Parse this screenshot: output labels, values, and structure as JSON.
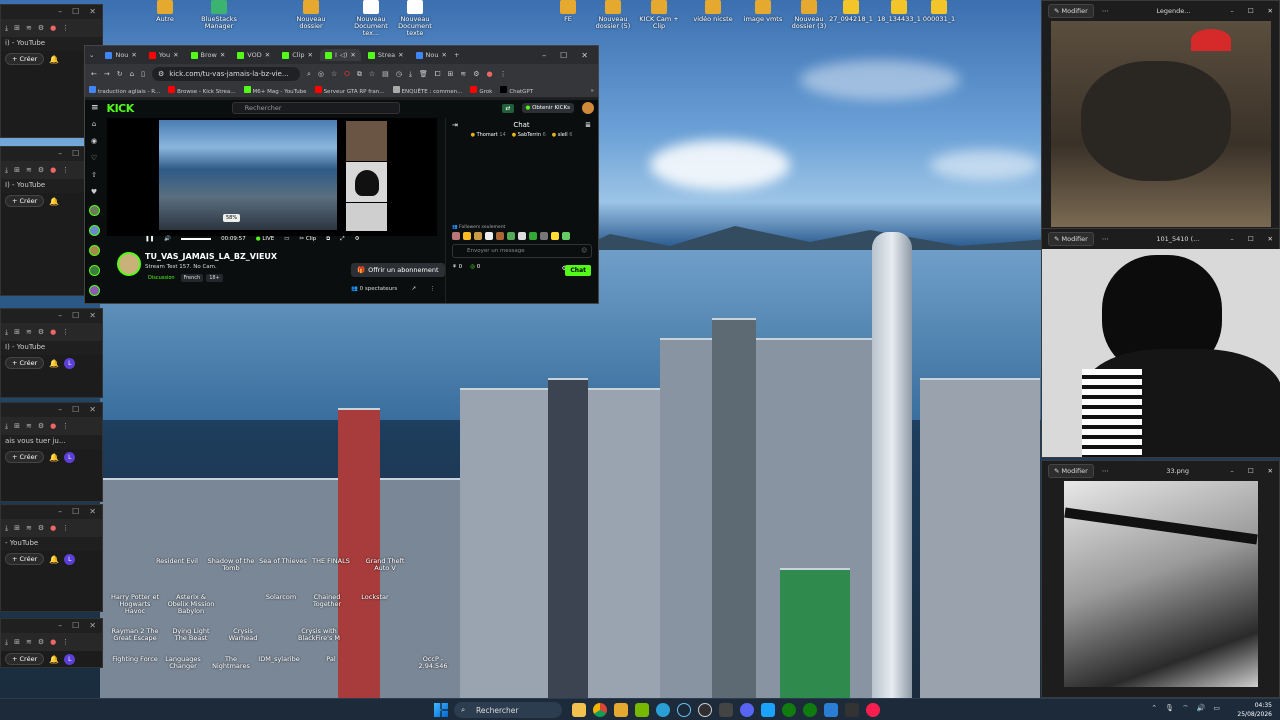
{
  "desktop_icons": [
    "Autre",
    "BlueStacks Manager",
    "Nouveau dossier",
    "Nouveau Document tex...",
    "Nouveau Document texte",
    "FE",
    "Nouveau dossier (5)",
    "KICK Cam + Clip",
    "vidéo nicste",
    "image vmts",
    "Nouveau dossier (3)",
    "27_094218_1",
    "18_134433_1",
    "000031_1"
  ],
  "game_icons": [
    "Resident Evil",
    "Shadow of the Tomb",
    "Sea of Thieves",
    "THE FINALS",
    "Grand Theft Auto V",
    "Harry Potter et Hogwarts Havoc",
    "Asterix & Obelix Mission Babylon",
    "Rayman 2 The Great Escape",
    "Dying Light The Beast",
    "Crysis Warhead",
    "Crysis with BlackFire's M",
    "Fighting Force",
    "Languages Changer",
    "The Nightmares",
    "IDM_sylaribe",
    "Pal",
    "Chained Together",
    "Lockstar",
    "Solarcom",
    "OccP - 2.94.546"
  ],
  "side_windows": [
    {
      "tab": "i) - YouTube",
      "creer": "Créer",
      "badge": ""
    },
    {
      "tab": "I) - YouTube",
      "creer": "Créer",
      "badge": ""
    },
    {
      "tab": "I) - YouTube",
      "creer": "Créer",
      "badge": "L"
    },
    {
      "tab": "ais vous tuer ju...",
      "creer": "Créer",
      "badge": "L"
    },
    {
      "tab": "- YouTube",
      "creer": "Créer",
      "badge": "L"
    },
    {
      "tab": "",
      "creer": "Créer",
      "badge": "L"
    }
  ],
  "browser": {
    "tabs": [
      "Nou",
      "You",
      "Brow",
      "VOD",
      "Clip",
      "I",
      "Strea",
      "Nou"
    ],
    "url": "kick.com/tu-vas-jamais-la-bz-vie...",
    "bookmarks": [
      "traduction agliais - R...",
      "Browse - Kick Strea...",
      "M6+ Mag - YouTube",
      "Serveur GTA RP fran...",
      "ENQUÊTE : commen...",
      "Grok",
      "ChatGPT"
    ]
  },
  "kick": {
    "logo": "KICK",
    "search_placeholder": "Rechercher",
    "get_kicks": "Obtenir KICKs",
    "stream_time": "00:09:57",
    "live_label": "LIVE",
    "clip_label": "Clip",
    "volume": "58%",
    "channel_name": "TU_VAS_JAMAIS_LA_BZ_VIEUX",
    "stream_title": "Stream Test 157. No Cam.",
    "tags": [
      "Discussion",
      "French",
      "18+"
    ],
    "subscribe": "Offrir un abonnement",
    "viewers": "0 spectateurs",
    "chat_header": "Chat",
    "gifters": [
      {
        "name": "Thomart",
        "count": "14"
      },
      {
        "name": "SabTerrin",
        "count": "6"
      },
      {
        "name": "slell",
        "count": "6"
      }
    ],
    "followers_only": "Followers seulement",
    "chat_placeholder": "Envoyer un message",
    "chat_button": "Chat",
    "chat_count": "0"
  },
  "viewers": [
    {
      "modify": "Modifier",
      "title": "Legende..."
    },
    {
      "modify": "Modifier",
      "title": "101_5410 (..."
    },
    {
      "modify": "Modifier",
      "title": "33.png"
    }
  ],
  "taskbar": {
    "search": "Rechercher",
    "time": "04:35",
    "date": "25/08/2026"
  }
}
